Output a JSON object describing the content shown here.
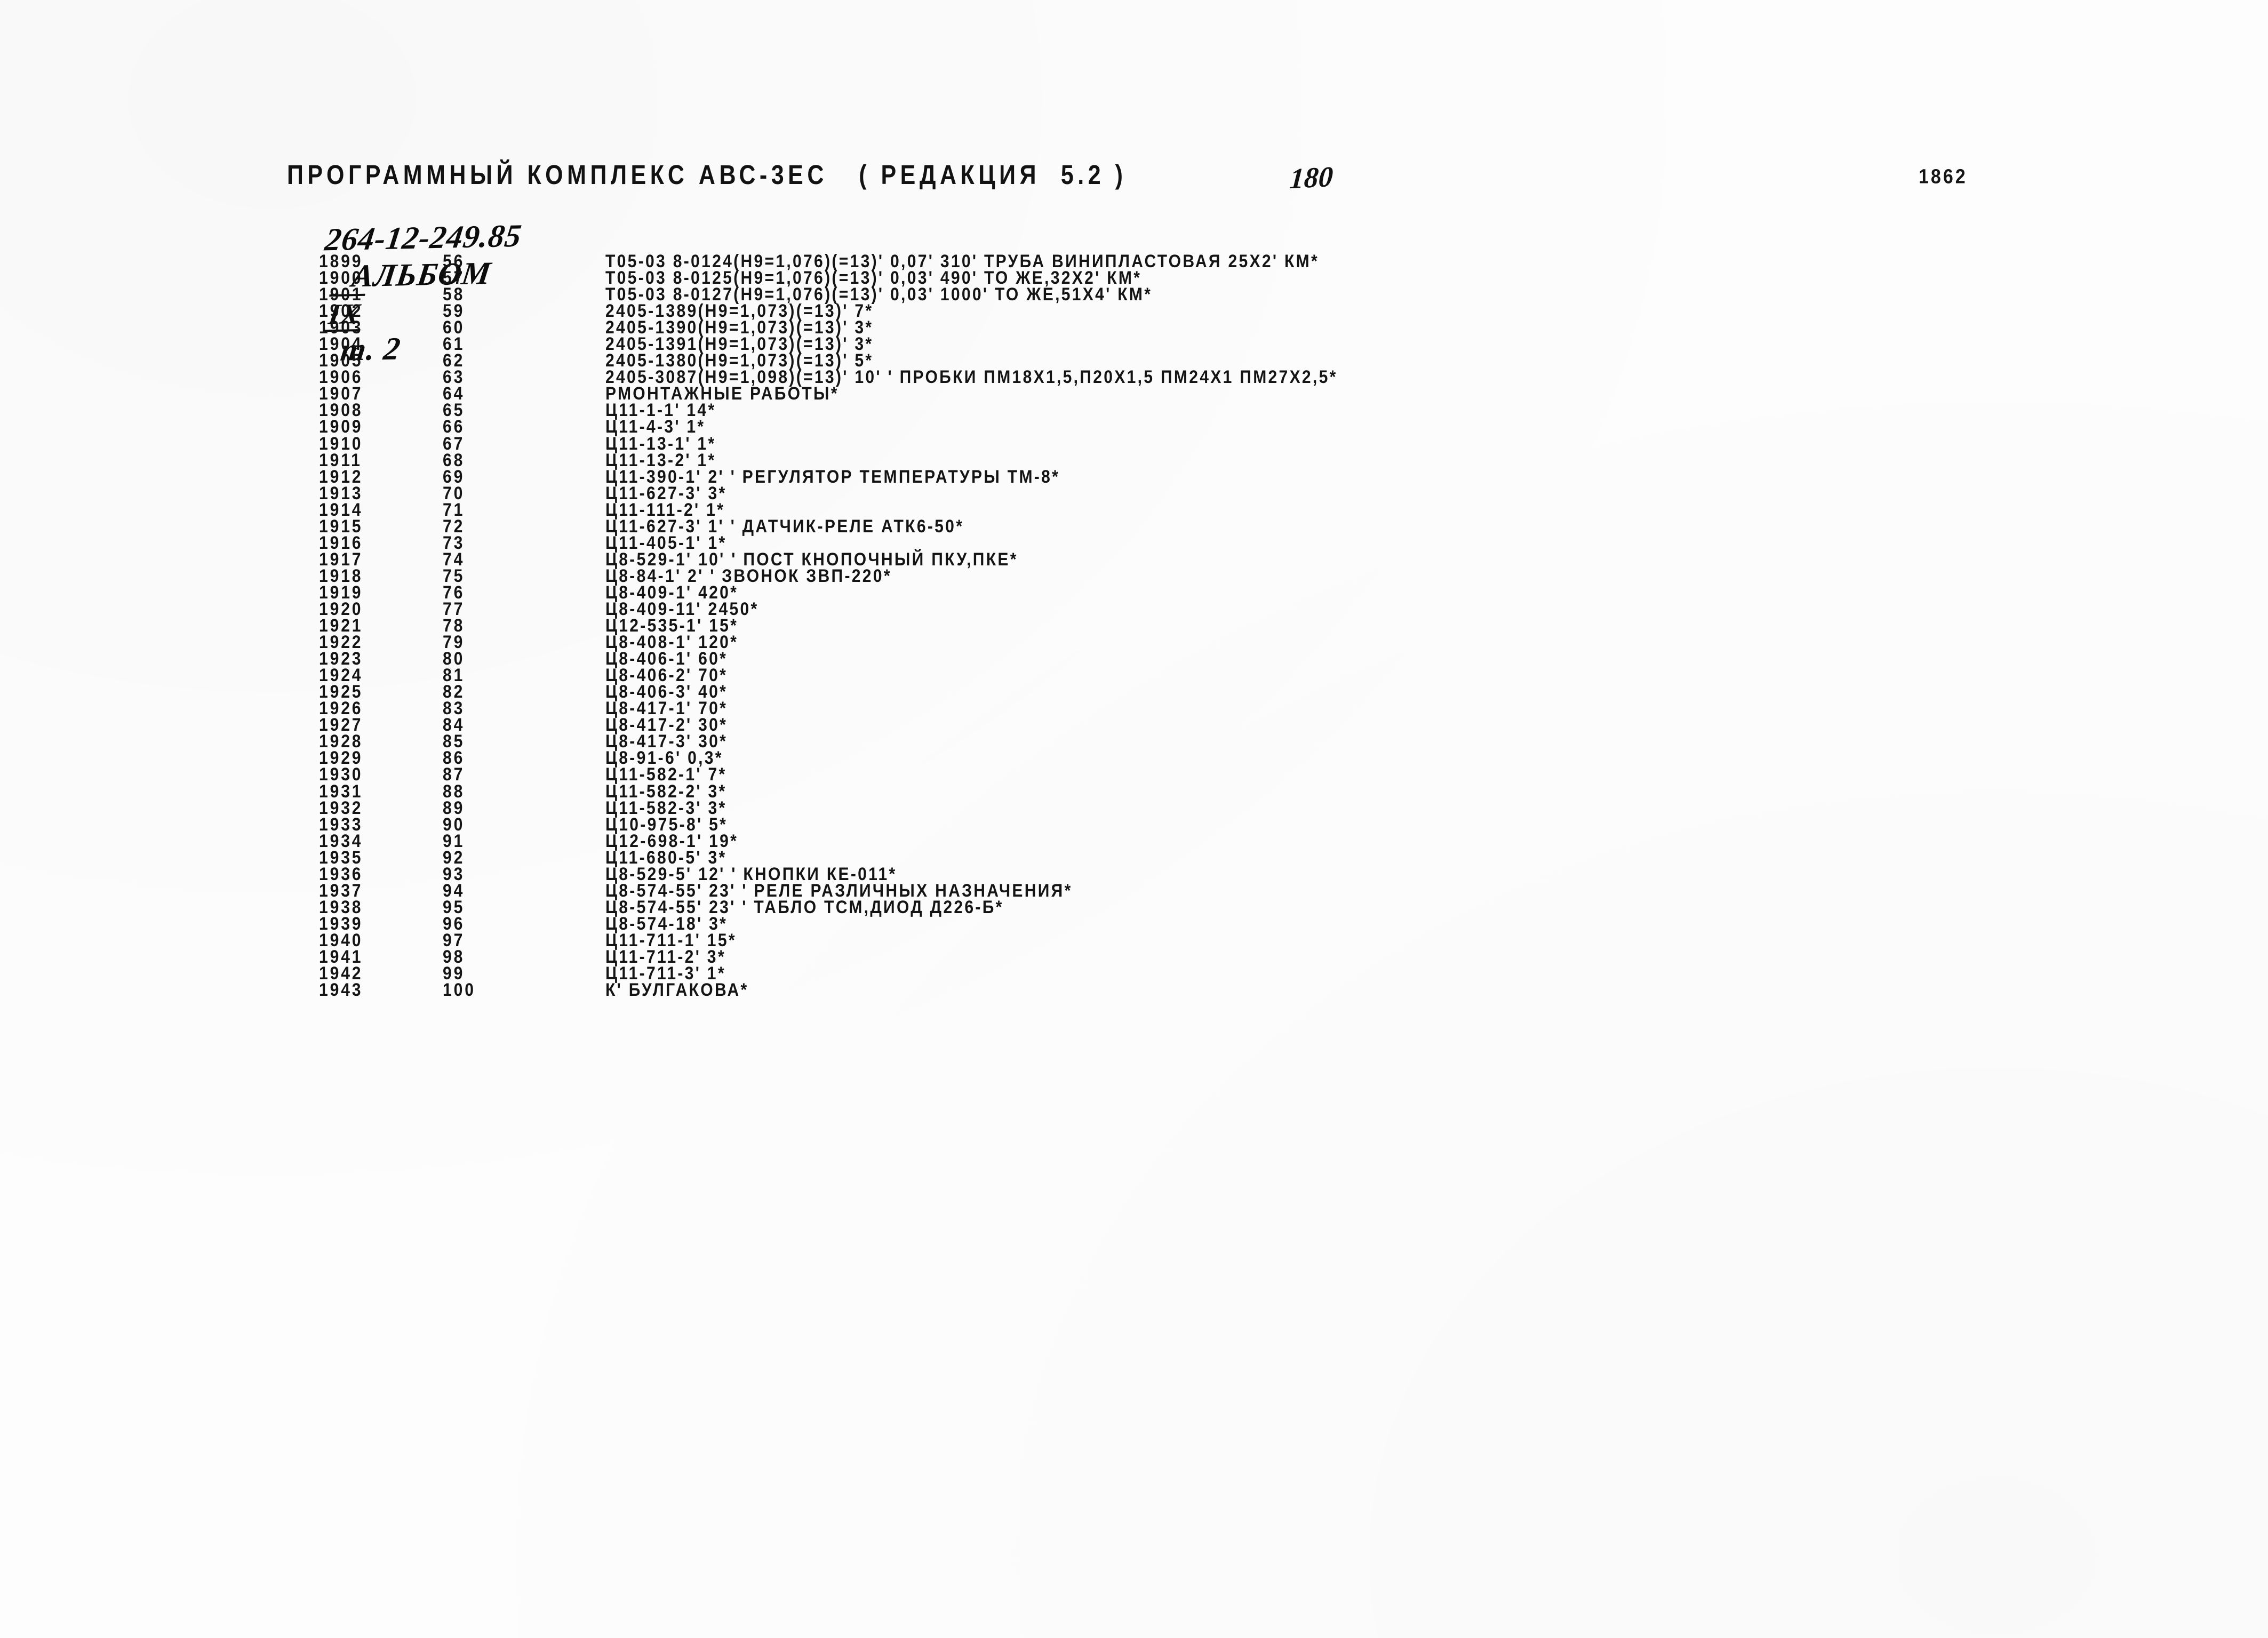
{
  "header": {
    "printed_line": "ПРОГРАММНЫЙ КОМПЛЕКС АВС-3ЕС   ( РЕДАКЦИЯ  5.2 )",
    "page_number": "180",
    "corner_number": "1862",
    "handwritten": {
      "code": "264-12-249.85",
      "album_label": "АЛЬБОМ",
      "album_roman": "IX",
      "tome": "т. 2"
    }
  },
  "table": {
    "columns": [
      "line_no",
      "seq_no",
      "text"
    ],
    "rows": [
      {
        "line_no": "1899",
        "seq_no": "56",
        "text": "Т05-03 8-0124(Н9=1,076)(=13)' 0,07' 310' ТРУБА ВИНИПЛАСТОВАЯ 25Х2' КМ*"
      },
      {
        "line_no": "1900",
        "seq_no": "57",
        "text": "Т05-03 8-0125(Н9=1,076)(=13)' 0,03' 490' ТО ЖЕ,32Х2' КМ*"
      },
      {
        "line_no": "1901",
        "seq_no": "58",
        "text": "Т05-03 8-0127(Н9=1,076)(=13)' 0,03' 1000' ТО ЖЕ,51Х4' КМ*"
      },
      {
        "line_no": "1902",
        "seq_no": "59",
        "text": "2405-1389(Н9=1,073)(=13)' 7*"
      },
      {
        "line_no": "1903",
        "seq_no": "60",
        "text": "2405-1390(Н9=1,073)(=13)' 3*"
      },
      {
        "line_no": "1904",
        "seq_no": "61",
        "text": "2405-1391(Н9=1,073)(=13)' 3*"
      },
      {
        "line_no": "1905",
        "seq_no": "62",
        "text": "2405-1380(Н9=1,073)(=13)' 5*"
      },
      {
        "line_no": "1906",
        "seq_no": "63",
        "text": "2405-3087(Н9=1,098)(=13)' 10' ' ПРОБКИ ПМ18Х1,5,П20Х1,5 ПМ24Х1 ПМ27Х2,5*"
      },
      {
        "line_no": "1907",
        "seq_no": "64",
        "text": "РМОНТАЖНЫЕ РАБОТЫ*"
      },
      {
        "line_no": "1908",
        "seq_no": "65",
        "text": "Ц11-1-1' 14*"
      },
      {
        "line_no": "1909",
        "seq_no": "66",
        "text": "Ц11-4-3' 1*"
      },
      {
        "line_no": "1910",
        "seq_no": "67",
        "text": "Ц11-13-1' 1*"
      },
      {
        "line_no": "1911",
        "seq_no": "68",
        "text": "Ц11-13-2' 1*"
      },
      {
        "line_no": "1912",
        "seq_no": "69",
        "text": "Ц11-390-1' 2' ' РЕГУЛЯТОР ТЕМПЕРАТУРЫ ТМ-8*"
      },
      {
        "line_no": "1913",
        "seq_no": "70",
        "text": "Ц11-627-3' 3*"
      },
      {
        "line_no": "1914",
        "seq_no": "71",
        "text": "Ц11-111-2' 1*"
      },
      {
        "line_no": "1915",
        "seq_no": "72",
        "text": "Ц11-627-3' 1' ' ДАТЧИК-РЕЛЕ АТК6-50*"
      },
      {
        "line_no": "1916",
        "seq_no": "73",
        "text": "Ц11-405-1' 1*"
      },
      {
        "line_no": "1917",
        "seq_no": "74",
        "text": "Ц8-529-1' 10' ' ПОСТ КНОПОЧНЫЙ ПКУ,ПКЕ*"
      },
      {
        "line_no": "1918",
        "seq_no": "75",
        "text": "Ц8-84-1' 2' ' ЗВОНОК ЗВП-220*"
      },
      {
        "line_no": "1919",
        "seq_no": "76",
        "text": "Ц8-409-1' 420*"
      },
      {
        "line_no": "1920",
        "seq_no": "77",
        "text": "Ц8-409-11' 2450*"
      },
      {
        "line_no": "1921",
        "seq_no": "78",
        "text": "Ц12-535-1' 15*"
      },
      {
        "line_no": "1922",
        "seq_no": "79",
        "text": "Ц8-408-1' 120*"
      },
      {
        "line_no": "1923",
        "seq_no": "80",
        "text": "Ц8-406-1' 60*"
      },
      {
        "line_no": "1924",
        "seq_no": "81",
        "text": "Ц8-406-2' 70*"
      },
      {
        "line_no": "1925",
        "seq_no": "82",
        "text": "Ц8-406-3' 40*"
      },
      {
        "line_no": "1926",
        "seq_no": "83",
        "text": "Ц8-417-1' 70*"
      },
      {
        "line_no": "1927",
        "seq_no": "84",
        "text": "Ц8-417-2' 30*"
      },
      {
        "line_no": "1928",
        "seq_no": "85",
        "text": "Ц8-417-3' 30*"
      },
      {
        "line_no": "1929",
        "seq_no": "86",
        "text": "Ц8-91-6' 0,3*"
      },
      {
        "line_no": "1930",
        "seq_no": "87",
        "text": "Ц11-582-1' 7*"
      },
      {
        "line_no": "1931",
        "seq_no": "88",
        "text": "Ц11-582-2' 3*"
      },
      {
        "line_no": "1932",
        "seq_no": "89",
        "text": "Ц11-582-3' 3*"
      },
      {
        "line_no": "1933",
        "seq_no": "90",
        "text": "Ц10-975-8' 5*"
      },
      {
        "line_no": "1934",
        "seq_no": "91",
        "text": "Ц12-698-1' 19*"
      },
      {
        "line_no": "1935",
        "seq_no": "92",
        "text": "Ц11-680-5' 3*"
      },
      {
        "line_no": "1936",
        "seq_no": "93",
        "text": "Ц8-529-5' 12' ' КНОПКИ КЕ-011*"
      },
      {
        "line_no": "1937",
        "seq_no": "94",
        "text": "Ц8-574-55' 23' ' РЕЛЕ РАЗЛИЧНЫХ НАЗНАЧЕНИЯ*"
      },
      {
        "line_no": "1938",
        "seq_no": "95",
        "text": "Ц8-574-55' 23' ' ТАБЛО ТСМ,ДИОД Д226-Б*"
      },
      {
        "line_no": "1939",
        "seq_no": "96",
        "text": "Ц8-574-18' 3*"
      },
      {
        "line_no": "1940",
        "seq_no": "97",
        "text": "Ц11-711-1' 15*"
      },
      {
        "line_no": "1941",
        "seq_no": "98",
        "text": "Ц11-711-2' 3*"
      },
      {
        "line_no": "1942",
        "seq_no": "99",
        "text": "Ц11-711-3' 1*"
      },
      {
        "line_no": "1943",
        "seq_no": "100",
        "text": "К' БУЛГАКОВА*"
      }
    ]
  },
  "colors": {
    "paper": "#fdfdfd",
    "ink": "#141414"
  }
}
